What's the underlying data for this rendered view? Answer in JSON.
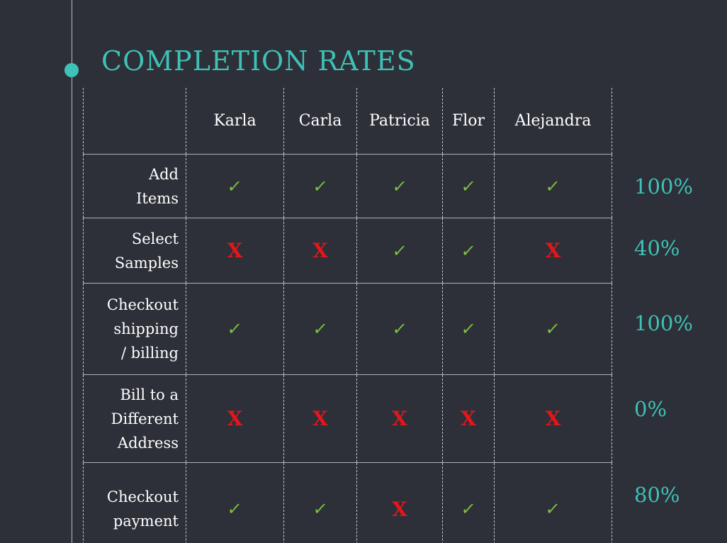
{
  "title": "COMPLETION RATES",
  "colors": {
    "background": "#2d3038",
    "accent": "#3ec1b6",
    "check": "#7dc242",
    "cross": "#e3161b"
  },
  "icons": {
    "pass": "check-icon",
    "fail": "cross-icon",
    "timeline": "timeline-dot-icon"
  },
  "symbols": {
    "pass": "✓",
    "fail": "X"
  },
  "columns": [
    "Karla",
    "Carla",
    "Patricia",
    "Flor",
    "Alejandra"
  ],
  "rows": [
    {
      "label": "Add\nItems",
      "results": [
        "pass",
        "pass",
        "pass",
        "pass",
        "pass"
      ],
      "rate": "100%"
    },
    {
      "label": "Select\nSamples",
      "results": [
        "fail",
        "fail",
        "pass",
        "pass",
        "fail"
      ],
      "rate": "40%"
    },
    {
      "label": "Checkout\nshipping\n/ billing",
      "results": [
        "pass",
        "pass",
        "pass",
        "pass",
        "pass"
      ],
      "rate": "100%"
    },
    {
      "label": "Bill to a\nDifferent\nAddress",
      "results": [
        "fail",
        "fail",
        "fail",
        "fail",
        "fail"
      ],
      "rate": "0%"
    },
    {
      "label": "Checkout\npayment",
      "results": [
        "pass",
        "pass",
        "fail",
        "pass",
        "pass"
      ],
      "rate": "80%"
    }
  ]
}
